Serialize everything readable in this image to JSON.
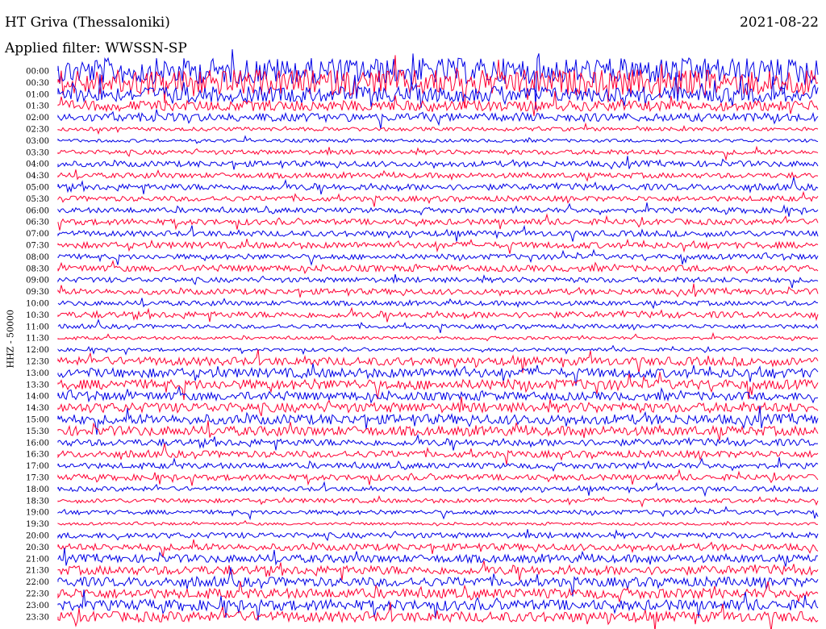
{
  "header": {
    "station": "HT Griva (Thessaloniki)",
    "date": "2021-08-22",
    "filter": "Applied filter: WWSSN-SP"
  },
  "chart_data": {
    "type": "line",
    "title": "HT Griva (Thessaloniki)",
    "ylabel": "HHZ - 50000",
    "xlabel": "",
    "trace_colors": [
      "#0000e6",
      "#ff0033"
    ],
    "row_labels": [
      "00:00",
      "00:30",
      "01:00",
      "01:30",
      "02:00",
      "02:30",
      "03:00",
      "03:30",
      "04:00",
      "04:30",
      "05:00",
      "05:30",
      "06:00",
      "06:30",
      "07:00",
      "07:30",
      "08:00",
      "08:30",
      "09:00",
      "09:30",
      "10:00",
      "10:30",
      "11:00",
      "11:30",
      "12:00",
      "12:30",
      "13:00",
      "13:30",
      "14:00",
      "14:30",
      "15:00",
      "15:30",
      "16:00",
      "16:30",
      "17:00",
      "17:30",
      "18:00",
      "18:30",
      "19:00",
      "19:30",
      "20:00",
      "20:30",
      "21:00",
      "21:30",
      "22:00",
      "22:30",
      "23:00",
      "23:30"
    ],
    "relative_amplitude": [
      5,
      5,
      3,
      2,
      1.6,
      0.7,
      0.6,
      0.9,
      1.1,
      1.0,
      1.2,
      1.0,
      1.0,
      1.1,
      1.1,
      1.2,
      1.0,
      1.2,
      1.0,
      1.1,
      0.9,
      1.2,
      0.8,
      0.6,
      0.6,
      1.6,
      1.8,
      1.9,
      1.6,
      1.9,
      1.9,
      1.8,
      1.3,
      1.3,
      1.1,
      1.1,
      0.9,
      0.8,
      0.8,
      0.5,
      1.1,
      1.3,
      1.5,
      1.7,
      1.8,
      1.9,
      2.0,
      2.0
    ]
  }
}
